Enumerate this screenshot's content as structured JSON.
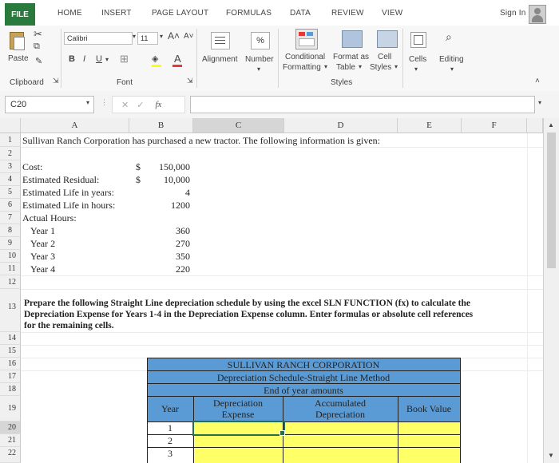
{
  "tabs": {
    "file": "FILE",
    "home": "HOME",
    "insert": "INSERT",
    "page_layout": "PAGE LAYOUT",
    "formulas": "FORMULAS",
    "data": "DATA",
    "review": "REVIEW",
    "view": "VIEW",
    "sign_in": "Sign In"
  },
  "ribbon": {
    "paste": "Paste",
    "font_name": "Calibri",
    "font_size": "11",
    "bold": "B",
    "italic": "I",
    "underline": "U",
    "alignment": "Alignment",
    "number": "Number",
    "conditional_formatting_1": "Conditional",
    "conditional_formatting_2": "Formatting",
    "format_table_1": "Format as",
    "format_table_2": "Table",
    "cell_styles_1": "Cell",
    "cell_styles_2": "Styles",
    "cells": "Cells",
    "editing": "Editing",
    "group_clipboard": "Clipboard",
    "group_font": "Font",
    "group_styles": "Styles",
    "percent": "%"
  },
  "formula_bar": {
    "name_box": "C20",
    "fx": "fx",
    "value": ""
  },
  "columns": [
    "A",
    "B",
    "C",
    "D",
    "E",
    "F"
  ],
  "rows": [
    "1",
    "2",
    "3",
    "4",
    "5",
    "6",
    "7",
    "8",
    "9",
    "10",
    "11",
    "12",
    "13",
    "14",
    "15",
    "16",
    "17",
    "18",
    "19",
    "20",
    "21",
    "22"
  ],
  "sheet": {
    "r1": "Sullivan Ranch Corporation has purchased a new tractor.  The following information is given:",
    "r3a": "Cost:",
    "r3cur": "$",
    "r3b": "150,000",
    "r4a": "Estimated Residual:",
    "r4cur": "$",
    "r4b": "10,000",
    "r5a": "Estimated Life in years:",
    "r5b": "4",
    "r6a": "Estimated Life in hours:",
    "r6b": "1200",
    "r7a": "Actual Hours:",
    "r8a": "Year 1",
    "r8b": "360",
    "r9a": "Year 2",
    "r9b": "270",
    "r10a": "Year 3",
    "r10b": "350",
    "r11a": "Year 4",
    "r11b": "220",
    "r13_line1": "Prepare the following Straight Line depreciation schedule by using the excel SLN FUNCTION (fx) to calculate the",
    "r13_line2": "Depreciation Expense for Years 1-4 in the Depreciation Expense column.  Enter formulas or absolute cell references",
    "r13_line3": "for the remaining cells.",
    "table_title1": "SULLIVAN RANCH CORPORATION",
    "table_title2": "Depreciation Schedule-Straight Line Method",
    "table_title3": "End of year amounts",
    "hdr_year": "Year",
    "hdr_dep1": "Depreciation",
    "hdr_dep2": "Expense",
    "hdr_acc1": "Accumulated",
    "hdr_acc2": "Depreciation",
    "hdr_book": "Book Value",
    "y1": "1",
    "y2": "2",
    "y3": "3"
  },
  "colors": {
    "file_tab": "#2b7a3d",
    "table_header": "#5b9bd5",
    "input_cells": "#ffff66"
  }
}
